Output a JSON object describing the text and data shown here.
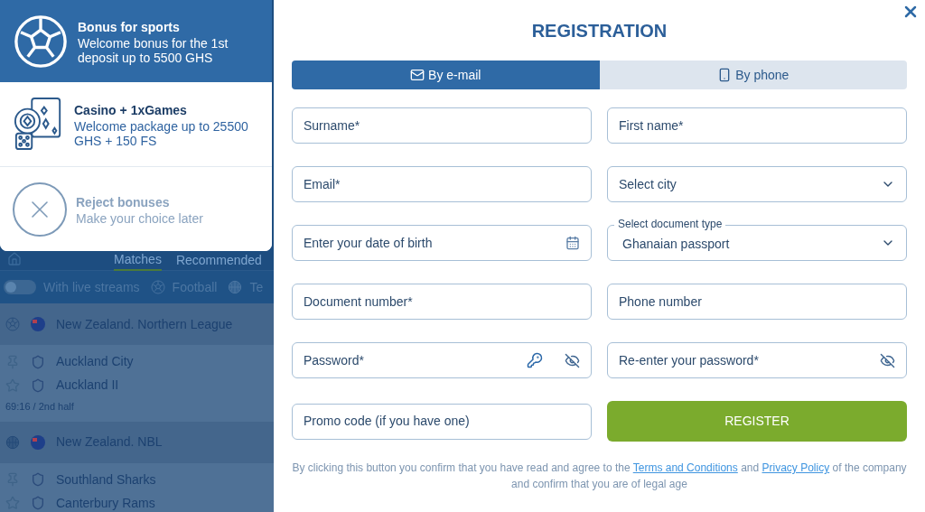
{
  "background": {
    "tabs": [
      {
        "label": "Matches",
        "selected": true
      },
      {
        "label": "Recommended",
        "selected": false
      }
    ],
    "live_streams": {
      "label": "With live streams",
      "on": false
    },
    "sports": [
      {
        "label": "Football",
        "kind": "football"
      },
      {
        "label": "Te",
        "kind": "tennis"
      }
    ],
    "groups": [
      {
        "league": "New Zealand. Northern League",
        "kind": "football",
        "matches": [
          {
            "teams": [
              "Auckland City",
              "Auckland II"
            ],
            "time": "69:16 / 2nd half"
          }
        ]
      },
      {
        "league": "New Zealand. NBL",
        "kind": "basketball",
        "matches": [
          {
            "teams": [
              "Southland Sharks",
              "Canterbury Rams"
            ]
          }
        ]
      }
    ]
  },
  "bonus_popup": {
    "options": [
      {
        "kind": "sports",
        "title": "Bonus for sports",
        "text": "Welcome bonus for the 1st deposit up to 5500 GHS",
        "selected": true
      },
      {
        "kind": "casino",
        "title": "Casino + 1xGames",
        "text": "Welcome package up to 25500 GHS + 150 FS",
        "selected": false
      },
      {
        "kind": "reject",
        "title": "Reject bonuses",
        "text": "Make your choice later",
        "selected": false
      }
    ]
  },
  "registration": {
    "title": "REGISTRATION",
    "tabs": [
      {
        "label": "By e-mail",
        "kind": "email",
        "selected": true
      },
      {
        "label": "By phone",
        "kind": "phone",
        "selected": false
      }
    ],
    "field_rows": [
      {
        "fields": [
          {
            "kind": "text",
            "placeholder": "Surname*"
          },
          {
            "kind": "text",
            "placeholder": "First name*"
          }
        ]
      },
      {
        "fields": [
          {
            "kind": "text",
            "placeholder": "Email*"
          },
          {
            "kind": "select",
            "placeholder": "Select city"
          }
        ]
      },
      {
        "fields": [
          {
            "kind": "date",
            "placeholder": "Enter your date of birth"
          },
          {
            "kind": "select",
            "label": "Select document type",
            "value": "Ghanaian passport"
          }
        ]
      },
      {
        "fields": [
          {
            "kind": "text",
            "placeholder": "Document number*"
          },
          {
            "kind": "text",
            "placeholder": "Phone number"
          }
        ]
      },
      {
        "fields": [
          {
            "kind": "password",
            "placeholder": "Password*",
            "generator": true
          },
          {
            "kind": "password",
            "placeholder": "Re-enter your password*",
            "generator": false
          }
        ]
      },
      {
        "fields": [
          {
            "kind": "text",
            "placeholder": "Promo code (if you have one)"
          }
        ]
      }
    ],
    "register_button": "REGISTER",
    "consent": {
      "before": "By clicking this button you confirm that you have read and agree to the",
      "link_1": "Terms and Conditions",
      "middle": "and",
      "link_2": "Privacy Policy",
      "after": "of the company and confirm that you are of legal age"
    }
  }
}
